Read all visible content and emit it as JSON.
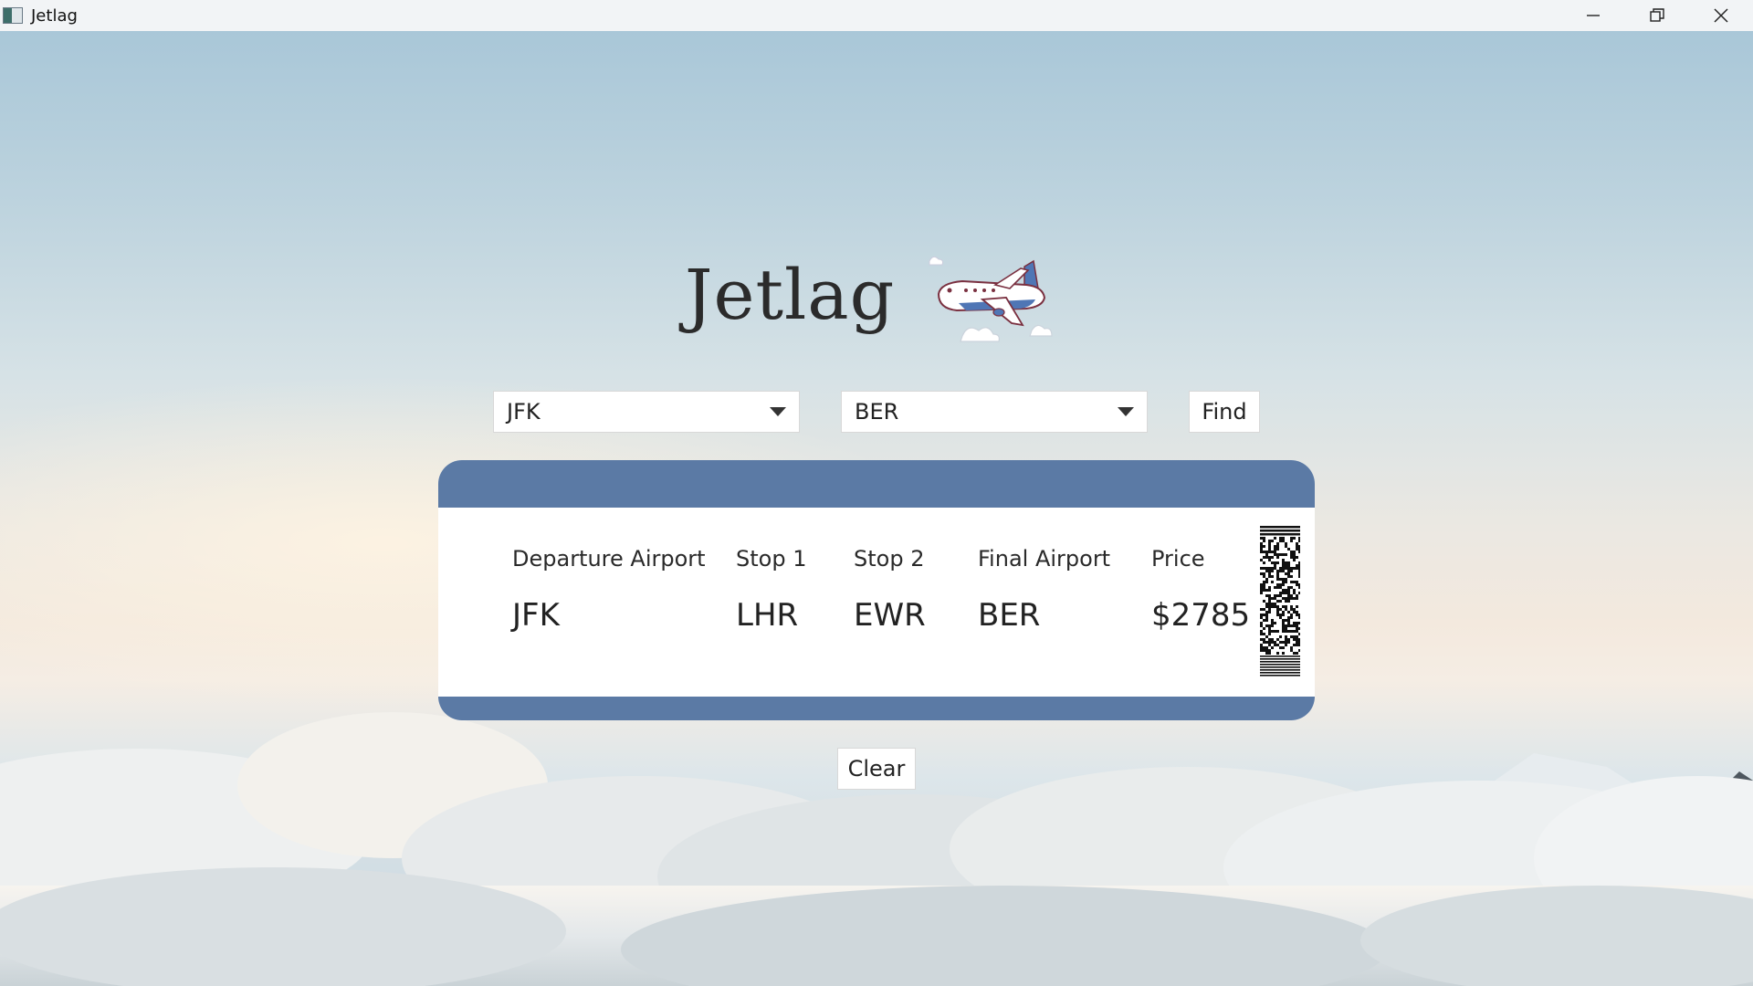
{
  "window": {
    "title": "Jetlag",
    "controls": [
      "minimize-icon",
      "restore-icon",
      "close-icon"
    ]
  },
  "header": {
    "title": "Jetlag",
    "illustration": "airplane-with-clouds"
  },
  "search": {
    "origin_value": "JFK",
    "destination_value": "BER",
    "find_label": "Find"
  },
  "ticket": {
    "accent_color": "#5b7aa5",
    "columns": [
      {
        "label": "Departure Airport",
        "value": "JFK"
      },
      {
        "label": "Stop 1",
        "value": "LHR"
      },
      {
        "label": "Stop 2",
        "value": "EWR"
      },
      {
        "label": "Final Airport",
        "value": "BER"
      },
      {
        "label": "Price",
        "value": "$2785"
      }
    ]
  },
  "actions": {
    "clear_label": "Clear"
  }
}
